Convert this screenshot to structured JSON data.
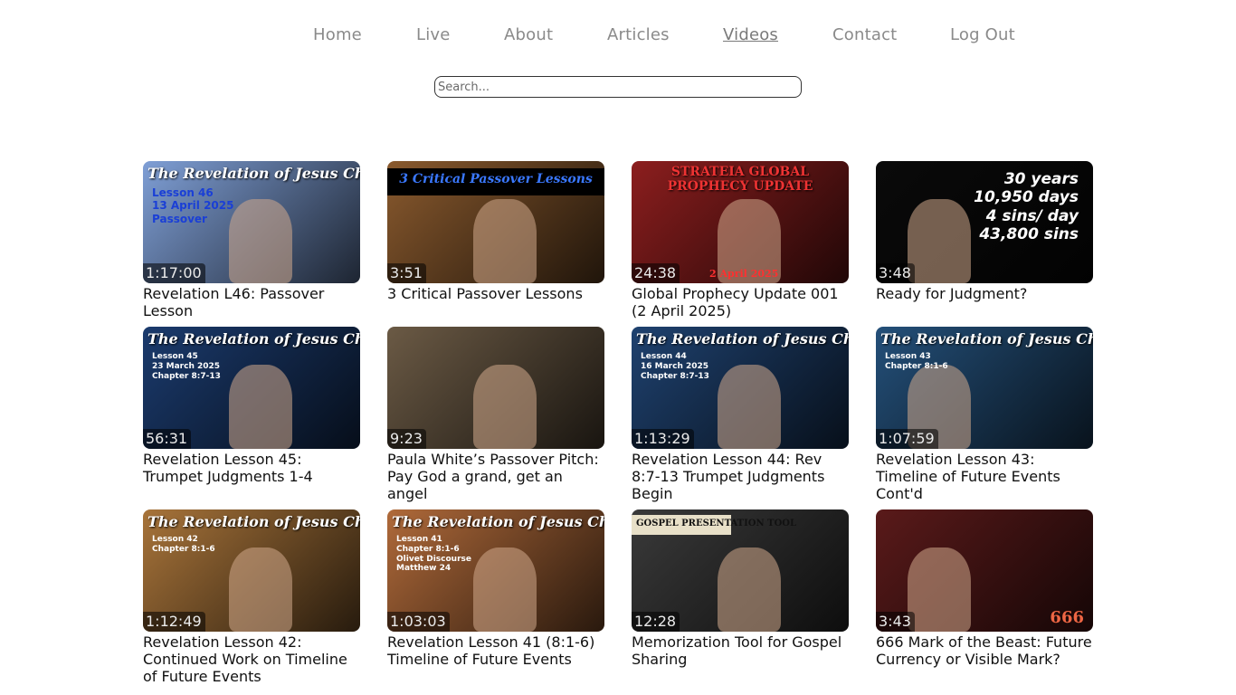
{
  "nav": {
    "items": [
      {
        "label": "Home",
        "name": "nav-home",
        "active": false
      },
      {
        "label": "Live",
        "name": "nav-live",
        "active": false
      },
      {
        "label": "About",
        "name": "nav-about",
        "active": false
      },
      {
        "label": "Articles",
        "name": "nav-articles",
        "active": false
      },
      {
        "label": "Videos",
        "name": "nav-videos",
        "active": true
      },
      {
        "label": "Contact",
        "name": "nav-contact",
        "active": false
      },
      {
        "label": "Log Out",
        "name": "nav-logout",
        "active": false
      }
    ]
  },
  "search": {
    "placeholder": "Search..."
  },
  "videos": [
    {
      "title": "Revelation L46: Passover Lesson",
      "duration": "1:17:00",
      "thumb_title": "The Revelation of Jesus Christ",
      "thumb_text": "Lesson 46\n13 April 2025\nPassover",
      "color": "#7f9fd6"
    },
    {
      "title": "3 Critical Passover Lessons",
      "duration": "3:51",
      "thumb_title": "3 Critical Passover Lessons",
      "thumb_text": "",
      "color": "#8a5a2e"
    },
    {
      "title": "Global Prophecy Update 001 (2 April 2025)",
      "duration": "24:38",
      "thumb_title": "STRATEIA GLOBAL PROPHECY UPDATE",
      "thumb_text": "2 April 2025",
      "color": "#8c1e1e"
    },
    {
      "title": "Ready for Judgment?",
      "duration": "3:48",
      "thumb_title": "",
      "thumb_text": "30 years\n10,950 days\n4 sins/ day\n43,800 sins",
      "color": "#0a0a0a"
    },
    {
      "title": "Revelation Lesson 45: Trumpet Judgments 1-4",
      "duration": "56:31",
      "thumb_title": "The Revelation of Jesus Christ",
      "thumb_text": "Lesson 45\n23 March 2025\nChapter 8:7-13",
      "color": "#1b3b6e"
    },
    {
      "title": "Paula White’s Passover Pitch: Pay God a grand, get an angel",
      "duration": "9:23",
      "thumb_title": "",
      "thumb_text": "",
      "color": "#6b5a45"
    },
    {
      "title": "Revelation Lesson 44: Rev 8:7-13 Trumpet Judgments Begin",
      "duration": "1:13:29",
      "thumb_title": "The Revelation of Jesus Christ",
      "thumb_text": "Lesson 44\n16 March 2025\nChapter 8:7-13",
      "color": "#1f4270"
    },
    {
      "title": "Revelation Lesson 43: Timeline of Future Events Cont'd",
      "duration": "1:07:59",
      "thumb_title": "The Revelation of Jesus Christ",
      "thumb_text": "Lesson 43\nChapter 8:1-6",
      "color": "#24507a"
    },
    {
      "title": "Revelation Lesson 42: Continued Work on Timeline of Future Events",
      "duration": "1:12:49",
      "thumb_title": "The Revelation of Jesus Christ",
      "thumb_text": "Lesson 42\nChapter 8:1-6",
      "color": "#a8743a"
    },
    {
      "title": "Revelation Lesson 41 (8:1-6) Timeline of Future Events",
      "duration": "1:03:03",
      "thumb_title": "The Revelation of Jesus Christ",
      "thumb_text": "Lesson 41\nChapter 8:1-6\nOlivet Discourse\nMatthew 24",
      "color": "#b06a3a"
    },
    {
      "title": "Memorization Tool for Gospel Sharing",
      "duration": "12:28",
      "thumb_title": "GOSPEL PRESENTATION TOOL",
      "thumb_text": "",
      "color": "#3a3a3a"
    },
    {
      "title": "666 Mark of the Beast: Future Currency or Visible Mark?",
      "duration": "3:43",
      "thumb_title": "",
      "thumb_text": "666",
      "color": "#5a1a1a"
    }
  ]
}
